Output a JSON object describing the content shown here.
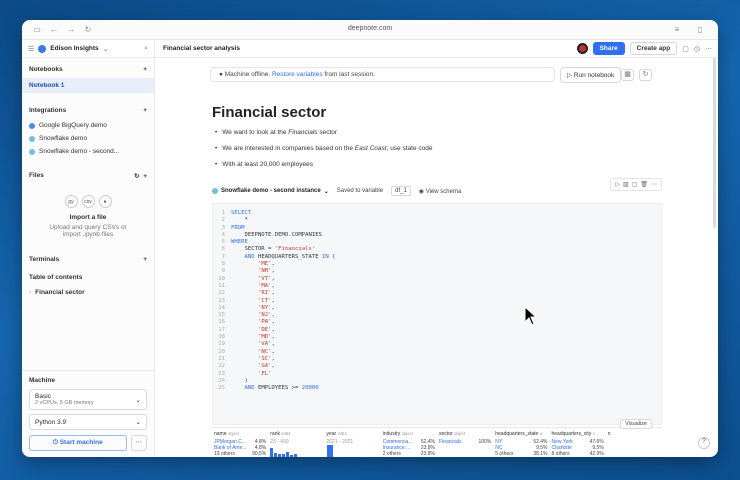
{
  "browser": {
    "url": "deepnote.com"
  },
  "header": {
    "workspace": "Edison Insights",
    "notebook_title": "Financial sector analysis",
    "share_label": "Share",
    "create_app_label": "Create app"
  },
  "sidebar": {
    "notebooks_title": "Notebooks",
    "notebooks": [
      "Notebook 1"
    ],
    "integrations_title": "Integrations",
    "integrations": [
      "Google BigQuery demo",
      "Snowflake demo",
      "Snowflake demo - second..."
    ],
    "files_title": "Files",
    "import_title": "Import a file",
    "import_desc_1": "Upload and query CSVs or",
    "import_desc_2": "import .ipynb files",
    "file_types": [
      "csv"
    ],
    "terminals_title": "Terminals",
    "toc_title": "Table of contents",
    "toc_items": [
      "Financial sector"
    ],
    "machine_title": "Machine",
    "machine_name": "Basic",
    "machine_specs": "2 vCPUs, 5 GB memory",
    "python_version": "Python 3.9",
    "start_label": "Start machine"
  },
  "notebook": {
    "offline_prefix": "Machine offline.",
    "offline_link": "Restore variables",
    "offline_suffix": "from last session.",
    "run_label": "Run notebook",
    "heading": "Financial sector",
    "bullet_1_a": "We want to look at the ",
    "bullet_1_em": "Financials",
    "bullet_1_b": " sector",
    "bullet_2_a": "We are interested in companies based on the ",
    "bullet_2_em": "East Coast",
    "bullet_2_b": ", use state code",
    "bullet_3": "With at least 20,000 employees",
    "cell_source": "Snowflake demo - second instance",
    "saved_to": "Saved to variable",
    "variable": "df_1",
    "view_schema": "View schema",
    "visualize": "Visualize"
  },
  "code_lines": [
    [
      [
        "kw",
        "SELECT"
      ]
    ],
    [
      [
        "txt",
        "    *"
      ]
    ],
    [
      [
        "kw",
        "FROM"
      ]
    ],
    [
      [
        "txt",
        "    DEEPNOTE.DEMO.COMPANIES"
      ]
    ],
    [
      [
        "kw",
        "WHERE"
      ]
    ],
    [
      [
        "txt",
        "    SECTOR = "
      ],
      [
        "str",
        "'Financials'"
      ]
    ],
    [
      [
        "txt",
        "    "
      ],
      [
        "kw",
        "AND"
      ],
      [
        "txt",
        " HEADQUARTERS_STATE "
      ],
      [
        "kw",
        "IN"
      ],
      [
        "txt",
        " ("
      ]
    ],
    [
      [
        "txt",
        "        "
      ],
      [
        "str",
        "'ME'"
      ],
      [
        "txt",
        ","
      ]
    ],
    [
      [
        "txt",
        "        "
      ],
      [
        "str",
        "'NH'"
      ],
      [
        "txt",
        ","
      ]
    ],
    [
      [
        "txt",
        "        "
      ],
      [
        "str",
        "'VT'"
      ],
      [
        "txt",
        ","
      ]
    ],
    [
      [
        "txt",
        "        "
      ],
      [
        "str",
        "'MA'"
      ],
      [
        "txt",
        ","
      ]
    ],
    [
      [
        "txt",
        "        "
      ],
      [
        "str",
        "'RI'"
      ],
      [
        "txt",
        ","
      ]
    ],
    [
      [
        "txt",
        "        "
      ],
      [
        "str",
        "'CT'"
      ],
      [
        "txt",
        ","
      ]
    ],
    [
      [
        "txt",
        "        "
      ],
      [
        "str",
        "'NY'"
      ],
      [
        "txt",
        ","
      ]
    ],
    [
      [
        "txt",
        "        "
      ],
      [
        "str",
        "'NJ'"
      ],
      [
        "txt",
        ","
      ]
    ],
    [
      [
        "txt",
        "        "
      ],
      [
        "str",
        "'PA'"
      ],
      [
        "txt",
        ","
      ]
    ],
    [
      [
        "txt",
        "        "
      ],
      [
        "str",
        "'DE'"
      ],
      [
        "txt",
        ","
      ]
    ],
    [
      [
        "txt",
        "        "
      ],
      [
        "str",
        "'MD'"
      ],
      [
        "txt",
        ","
      ]
    ],
    [
      [
        "txt",
        "        "
      ],
      [
        "str",
        "'VA'"
      ],
      [
        "txt",
        ","
      ]
    ],
    [
      [
        "txt",
        "        "
      ],
      [
        "str",
        "'NC'"
      ],
      [
        "txt",
        ","
      ]
    ],
    [
      [
        "txt",
        "        "
      ],
      [
        "str",
        "'SC'"
      ],
      [
        "txt",
        ","
      ]
    ],
    [
      [
        "txt",
        "        "
      ],
      [
        "str",
        "'GA'"
      ],
      [
        "txt",
        ","
      ]
    ],
    [
      [
        "txt",
        "        "
      ],
      [
        "str",
        "'FL'"
      ]
    ],
    [
      [
        "txt",
        "    )"
      ]
    ],
    [
      [
        "txt",
        "    "
      ],
      [
        "kw",
        "AND"
      ],
      [
        "txt",
        " EMPLOYEES >= "
      ],
      [
        "kw",
        "20000"
      ]
    ]
  ],
  "results": {
    "columns": [
      {
        "name": "name",
        "type": "object",
        "rows": [
          [
            "JPMorgan C...",
            "4.8%"
          ],
          [
            "Bank of Ame...",
            "4.8%"
          ],
          [
            "19 others",
            "90.5%"
          ]
        ]
      },
      {
        "name": "rank",
        "type": "int64",
        "range": "23 - 439",
        "bars": [
          9,
          4,
          3,
          3,
          5,
          2,
          3
        ]
      },
      {
        "name": "year",
        "type": "int64",
        "range": "2021 - 2021",
        "bars": [
          12
        ]
      },
      {
        "name": "industry",
        "type": "object",
        "rows": [
          [
            "Commercia...",
            "52.4%"
          ],
          [
            "Insurance:...",
            "23.8%"
          ],
          [
            "2 others",
            "23.8%"
          ]
        ]
      },
      {
        "name": "sector",
        "type": "object",
        "rows": [
          [
            "Financials",
            "100%"
          ]
        ]
      },
      {
        "name": "headquarters_state",
        "type": "o",
        "rows": [
          [
            "NY",
            "52.4%"
          ],
          [
            "NC",
            "9.5%"
          ],
          [
            "5 others",
            "38.1%"
          ]
        ]
      },
      {
        "name": "headquarters_city",
        "type": "o",
        "rows": [
          [
            "New York",
            "47.6%"
          ],
          [
            "Charlotte",
            "9.5%"
          ],
          [
            "8 others",
            "42.9%"
          ]
        ]
      },
      {
        "name": "n",
        "type": "",
        "rows": []
      }
    ]
  }
}
